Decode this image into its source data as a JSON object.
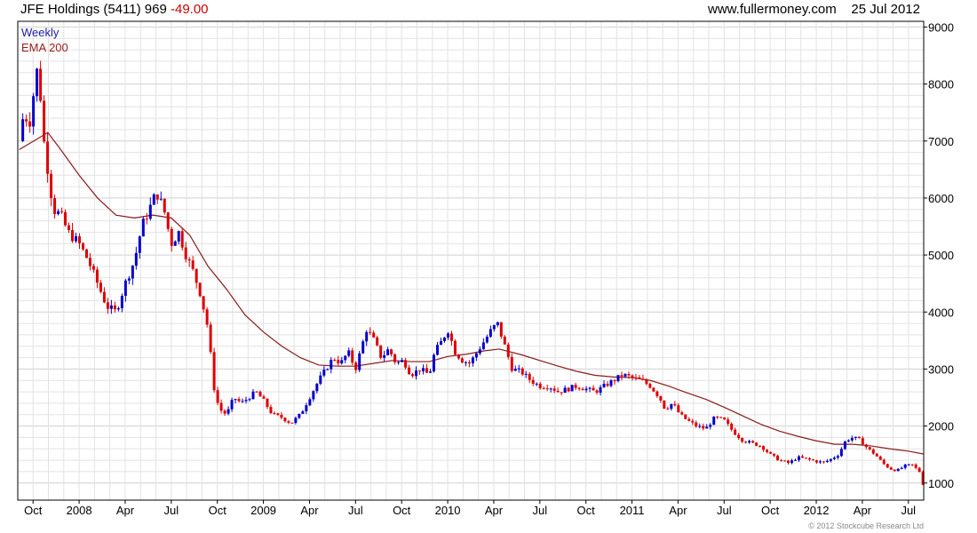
{
  "header": {
    "title": "JFE Holdings (5411) 969",
    "change": "-49.00",
    "website": "www.fullermoney.com",
    "date": "25 Jul 2012"
  },
  "legend": [
    {
      "label": "Weekly",
      "color": "#1a1aa6"
    },
    {
      "label": "EMA 200",
      "color": "#9b1c1c"
    }
  ],
  "copyright": "© 2012 Stockcube Research Ltd",
  "colors": {
    "up": "#0000cc",
    "down": "#dd0000",
    "ema": "#8b1a1a",
    "grid": "#e2e2e2"
  },
  "chart_data": {
    "type": "candlestick",
    "title": "JFE Holdings (5411) 969",
    "yticks": [
      1000,
      2000,
      3000,
      4000,
      5000,
      6000,
      7000,
      8000,
      9000
    ],
    "ylim": [
      700,
      9100
    ],
    "xlim": [
      2007.667,
      2012.583
    ],
    "grid": true,
    "xticks": [
      {
        "label": "Oct",
        "x": 2007.75
      },
      {
        "label": "2008",
        "x": 2008.0
      },
      {
        "label": "Apr",
        "x": 2008.25
      },
      {
        "label": "Jul",
        "x": 2008.5
      },
      {
        "label": "Oct",
        "x": 2008.75
      },
      {
        "label": "2009",
        "x": 2009.0
      },
      {
        "label": "Apr",
        "x": 2009.25
      },
      {
        "label": "Jul",
        "x": 2009.5
      },
      {
        "label": "Oct",
        "x": 2009.75
      },
      {
        "label": "2010",
        "x": 2010.0
      },
      {
        "label": "Apr",
        "x": 2010.25
      },
      {
        "label": "Jul",
        "x": 2010.5
      },
      {
        "label": "Oct",
        "x": 2010.75
      },
      {
        "label": "2011",
        "x": 2011.0
      },
      {
        "label": "Apr",
        "x": 2011.25
      },
      {
        "label": "Jul",
        "x": 2011.5
      },
      {
        "label": "Oct",
        "x": 2011.75
      },
      {
        "label": "2012",
        "x": 2012.0
      },
      {
        "label": "Apr",
        "x": 2012.25
      },
      {
        "label": "Jul",
        "x": 2012.5
      }
    ],
    "price_path": [
      [
        2007.675,
        7000
      ],
      [
        2007.7,
        7500
      ],
      [
        2007.73,
        7300
      ],
      [
        2007.76,
        8000
      ],
      [
        2007.78,
        8400
      ],
      [
        2007.8,
        7200
      ],
      [
        2007.83,
        6500
      ],
      [
        2007.86,
        5800
      ],
      [
        2007.9,
        5700
      ],
      [
        2007.94,
        5400
      ],
      [
        2008.0,
        5200
      ],
      [
        2008.05,
        4900
      ],
      [
        2008.1,
        4500
      ],
      [
        2008.15,
        4100
      ],
      [
        2008.2,
        4000
      ],
      [
        2008.25,
        4500
      ],
      [
        2008.3,
        4900
      ],
      [
        2008.34,
        5500
      ],
      [
        2008.38,
        5800
      ],
      [
        2008.42,
        6100
      ],
      [
        2008.46,
        5800
      ],
      [
        2008.5,
        5200
      ],
      [
        2008.54,
        5400
      ],
      [
        2008.58,
        5000
      ],
      [
        2008.62,
        4700
      ],
      [
        2008.66,
        4300
      ],
      [
        2008.7,
        3700
      ],
      [
        2008.73,
        2700
      ],
      [
        2008.76,
        2300
      ],
      [
        2008.8,
        2200
      ],
      [
        2008.84,
        2500
      ],
      [
        2008.88,
        2400
      ],
      [
        2008.92,
        2500
      ],
      [
        2008.96,
        2600
      ],
      [
        2009.0,
        2450
      ],
      [
        2009.05,
        2200
      ],
      [
        2009.1,
        2150
      ],
      [
        2009.15,
        2050
      ],
      [
        2009.2,
        2200
      ],
      [
        2009.25,
        2500
      ],
      [
        2009.3,
        2800
      ],
      [
        2009.34,
        3000
      ],
      [
        2009.38,
        3200
      ],
      [
        2009.42,
        3100
      ],
      [
        2009.46,
        3300
      ],
      [
        2009.5,
        3000
      ],
      [
        2009.53,
        3350
      ],
      [
        2009.56,
        3700
      ],
      [
        2009.6,
        3500
      ],
      [
        2009.64,
        3200
      ],
      [
        2009.68,
        3350
      ],
      [
        2009.72,
        3100
      ],
      [
        2009.76,
        3150
      ],
      [
        2009.8,
        2900
      ],
      [
        2009.85,
        3000
      ],
      [
        2009.9,
        2900
      ],
      [
        2009.93,
        3300
      ],
      [
        2009.97,
        3500
      ],
      [
        2010.0,
        3700
      ],
      [
        2010.04,
        3300
      ],
      [
        2010.08,
        3150
      ],
      [
        2010.12,
        3100
      ],
      [
        2010.16,
        3300
      ],
      [
        2010.2,
        3500
      ],
      [
        2010.24,
        3700
      ],
      [
        2010.27,
        3800
      ],
      [
        2010.3,
        3500
      ],
      [
        2010.35,
        3000
      ],
      [
        2010.4,
        2950
      ],
      [
        2010.45,
        2800
      ],
      [
        2010.5,
        2700
      ],
      [
        2010.55,
        2700
      ],
      [
        2010.6,
        2600
      ],
      [
        2010.65,
        2650
      ],
      [
        2010.7,
        2700
      ],
      [
        2010.75,
        2650
      ],
      [
        2010.8,
        2600
      ],
      [
        2010.85,
        2700
      ],
      [
        2010.9,
        2800
      ],
      [
        2010.95,
        2900
      ],
      [
        2011.0,
        2850
      ],
      [
        2011.05,
        2800
      ],
      [
        2011.1,
        2700
      ],
      [
        2011.15,
        2500
      ],
      [
        2011.18,
        2300
      ],
      [
        2011.22,
        2400
      ],
      [
        2011.26,
        2200
      ],
      [
        2011.3,
        2100
      ],
      [
        2011.35,
        2000
      ],
      [
        2011.4,
        1950
      ],
      [
        2011.45,
        2150
      ],
      [
        2011.5,
        2100
      ],
      [
        2011.55,
        1900
      ],
      [
        2011.6,
        1750
      ],
      [
        2011.65,
        1700
      ],
      [
        2011.7,
        1650
      ],
      [
        2011.75,
        1500
      ],
      [
        2011.8,
        1400
      ],
      [
        2011.85,
        1350
      ],
      [
        2011.9,
        1450
      ],
      [
        2011.95,
        1420
      ],
      [
        2012.0,
        1380
      ],
      [
        2012.04,
        1360
      ],
      [
        2012.08,
        1420
      ],
      [
        2012.12,
        1500
      ],
      [
        2012.16,
        1750
      ],
      [
        2012.2,
        1800
      ],
      [
        2012.24,
        1750
      ],
      [
        2012.28,
        1600
      ],
      [
        2012.32,
        1500
      ],
      [
        2012.36,
        1350
      ],
      [
        2012.4,
        1250
      ],
      [
        2012.44,
        1220
      ],
      [
        2012.48,
        1300
      ],
      [
        2012.52,
        1320
      ],
      [
        2012.56,
        1200
      ],
      [
        2012.58,
        969
      ]
    ],
    "ema200_path": [
      [
        2007.675,
        6850
      ],
      [
        2007.78,
        7050
      ],
      [
        2007.83,
        7150
      ],
      [
        2007.9,
        6850
      ],
      [
        2008.0,
        6400
      ],
      [
        2008.1,
        6000
      ],
      [
        2008.2,
        5700
      ],
      [
        2008.3,
        5650
      ],
      [
        2008.4,
        5700
      ],
      [
        2008.5,
        5650
      ],
      [
        2008.6,
        5350
      ],
      [
        2008.7,
        4800
      ],
      [
        2008.8,
        4400
      ],
      [
        2008.9,
        3950
      ],
      [
        2009.0,
        3650
      ],
      [
        2009.1,
        3400
      ],
      [
        2009.2,
        3200
      ],
      [
        2009.3,
        3070
      ],
      [
        2009.4,
        3050
      ],
      [
        2009.5,
        3050
      ],
      [
        2009.6,
        3100
      ],
      [
        2009.7,
        3150
      ],
      [
        2009.8,
        3130
      ],
      [
        2009.9,
        3130
      ],
      [
        2010.0,
        3220
      ],
      [
        2010.1,
        3260
      ],
      [
        2010.2,
        3320
      ],
      [
        2010.28,
        3350
      ],
      [
        2010.4,
        3250
      ],
      [
        2010.5,
        3150
      ],
      [
        2010.6,
        3050
      ],
      [
        2010.7,
        2960
      ],
      [
        2010.8,
        2890
      ],
      [
        2010.9,
        2860
      ],
      [
        2011.0,
        2850
      ],
      [
        2011.1,
        2800
      ],
      [
        2011.2,
        2700
      ],
      [
        2011.3,
        2580
      ],
      [
        2011.4,
        2470
      ],
      [
        2011.5,
        2330
      ],
      [
        2011.6,
        2180
      ],
      [
        2011.7,
        2030
      ],
      [
        2011.8,
        1910
      ],
      [
        2011.9,
        1820
      ],
      [
        2012.0,
        1740
      ],
      [
        2012.1,
        1680
      ],
      [
        2012.2,
        1680
      ],
      [
        2012.3,
        1650
      ],
      [
        2012.4,
        1600
      ],
      [
        2012.5,
        1560
      ],
      [
        2012.58,
        1510
      ]
    ]
  }
}
